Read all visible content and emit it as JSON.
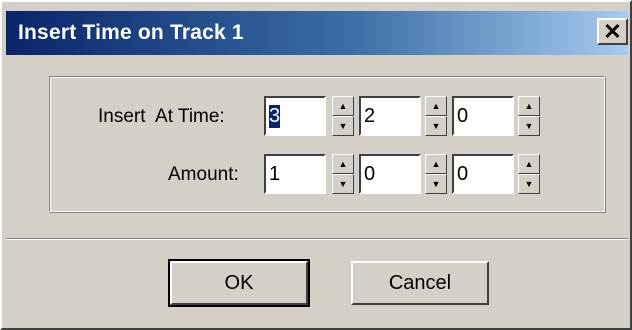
{
  "window": {
    "title": "Insert Time on Track 1",
    "close_glyph": "✕"
  },
  "form": {
    "insert_at_time": {
      "label": "Insert  At Time:",
      "values": [
        "3",
        "2",
        "0"
      ]
    },
    "amount": {
      "label": "Amount:",
      "values": [
        "1",
        "0",
        "0"
      ]
    }
  },
  "buttons": {
    "ok": "OK",
    "cancel": "Cancel"
  },
  "icons": {
    "spin_up": "▲",
    "spin_down": "▼"
  },
  "colors": {
    "titlebar_start": "#0a246a",
    "titlebar_end": "#a6caf0",
    "face": "#d4d0c8",
    "selection": "#0a246a"
  }
}
